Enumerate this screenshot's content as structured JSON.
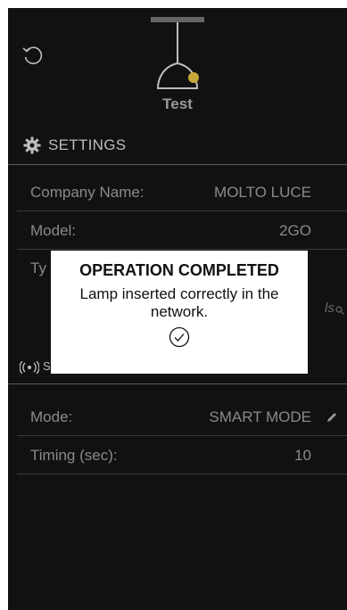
{
  "header": {
    "lamp_name": "Test"
  },
  "settings": {
    "title": "SETTINGS",
    "rows": [
      {
        "label": "Company Name:",
        "value": "MOLTO LUCE"
      },
      {
        "label": "Model:",
        "value": "2GO"
      },
      {
        "label": "Ty",
        "value": ""
      }
    ],
    "search_link": "ls"
  },
  "connection": {
    "letter": "S"
  },
  "mode_rows": [
    {
      "label": "Mode:",
      "value": "SMART MODE"
    },
    {
      "label": "Timing (sec):",
      "value": "10"
    }
  ],
  "dialog": {
    "title": "OPERATION COMPLETED",
    "message": "Lamp inserted correctly in the network."
  },
  "colors": {
    "background": "#111111",
    "lamp_accent": "#c8a83a",
    "text_dim": "#8a8a8a"
  },
  "icons": [
    "back-arrow-icon",
    "pendant-lamp-icon",
    "gear-icon",
    "search-icon",
    "connection-icon",
    "edit-pencil-icon",
    "checkmark-circle-icon"
  ]
}
